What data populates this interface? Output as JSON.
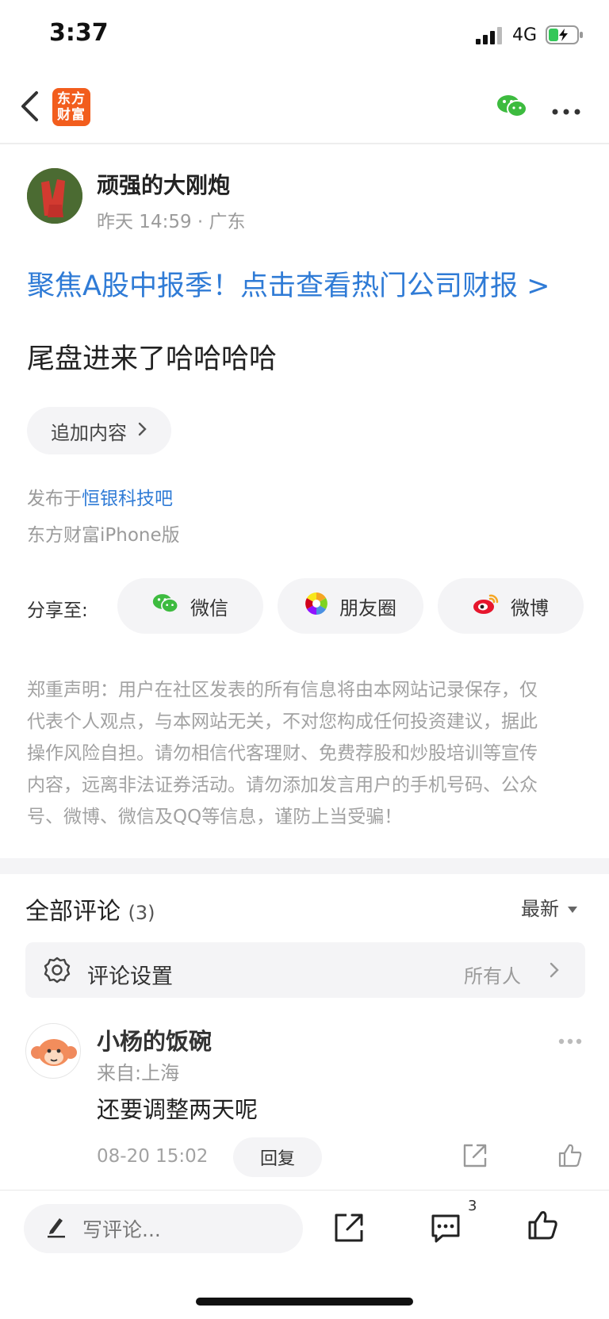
{
  "status_bar": {
    "time": "3:37",
    "network": "4G"
  },
  "nav": {
    "logo_text_line1": "东方",
    "logo_text_line2": "财富",
    "icons": [
      "back-icon",
      "wechat-icon",
      "more-icon"
    ]
  },
  "post": {
    "author_name": "顽强的大刚炮",
    "author_meta": "昨天 14:59 · 广东",
    "promo_link": "聚焦A股中报季！点击查看热门公司财报 >",
    "content": "尾盘进来了哈哈哈哈",
    "append_label": "追加内容",
    "published_prefix": "发布于",
    "forum_name": "恒银科技吧",
    "client": "东方财富iPhone版"
  },
  "share": {
    "label": "分享至:",
    "targets": [
      {
        "label": "微信",
        "icon": "wechat-icon",
        "color": "#3dbb3f"
      },
      {
        "label": "朋友圈",
        "icon": "moments-icon",
        "color": "#f5a623"
      },
      {
        "label": "微博",
        "icon": "weibo-icon",
        "color": "#e6162d"
      }
    ]
  },
  "disclaimer_lines": [
    "郑重声明：用户在社区发表的所有信息将由本网站记录保存，仅",
    "代表个人观点，与本网站无关，不对您构成任何投资建议，据此",
    "操作风险自担。请勿相信代客理财、免费荐股和炒股培训等宣传",
    "内容，远离非法证券活动。请勿添加发言用户的手机号码、公众",
    "号、微博、微信及QQ等信息，谨防上当受骗！"
  ],
  "comments": {
    "title": "全部评论",
    "count": "(3)",
    "sort_label": "最新",
    "settings_label": "评论设置",
    "settings_value": "所有人",
    "items": [
      {
        "user": "小杨的饭碗",
        "location": "来自:上海",
        "text": "还要调整两天呢",
        "time": "08-20 15:02",
        "reply_label": "回复"
      }
    ]
  },
  "bottom_bar": {
    "write_placeholder": "写评论...",
    "comment_count": "3"
  },
  "colors": {
    "accent_blue": "#2f7bd6",
    "brand_orange": "#f25d1d",
    "wechat_green": "#3dbb3f"
  }
}
